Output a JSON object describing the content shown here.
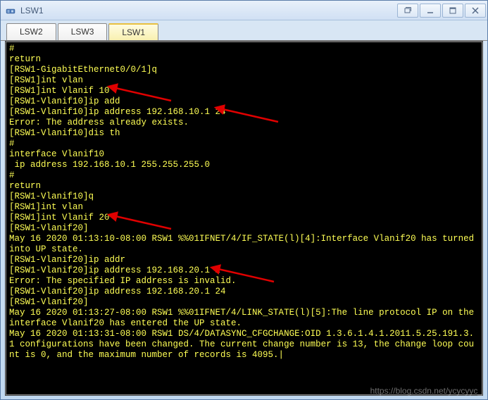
{
  "window": {
    "title": "LSW1"
  },
  "tabs": [
    {
      "label": "LSW2",
      "active": false
    },
    {
      "label": "LSW3",
      "active": false
    },
    {
      "label": "LSW1",
      "active": true
    }
  ],
  "terminal": {
    "lines": [
      "#",
      "return",
      "[RSW1-GigabitEthernet0/0/1]q",
      "[RSW1]int vlan",
      "[RSW1]int Vlanif 10",
      "[RSW1-Vlanif10]ip add",
      "[RSW1-Vlanif10]ip address 192.168.10.1 24",
      "Error: The address already exists.",
      "[RSW1-Vlanif10]dis th",
      "#",
      "interface Vlanif10",
      " ip address 192.168.10.1 255.255.255.0",
      "#",
      "return",
      "[RSW1-Vlanif10]q",
      "[RSW1]int vlan",
      "[RSW1]int Vlanif 20",
      "[RSW1-Vlanif20]",
      "May 16 2020 01:13:10-08:00 RSW1 %%01IFNET/4/IF_STATE(l)[4]:Interface Vlanif20 has turned into UP state.",
      "[RSW1-Vlanif20]ip addr",
      "[RSW1-Vlanif20]ip address 192.168.20.1 2",
      "Error: The specified IP address is invalid.",
      "[RSW1-Vlanif20]ip address 192.168.20.1 24",
      "[RSW1-Vlanif20]",
      "May 16 2020 01:13:27-08:00 RSW1 %%01IFNET/4/LINK_STATE(l)[5]:The line protocol IP on the interface Vlanif20 has entered the UP state.",
      "May 16 2020 01:13:31-08:00 RSW1 DS/4/DATASYNC_CFGCHANGE:OID 1.3.6.1.4.1.2011.5.25.191.3.1 configurations have been changed. The current change number is 13, the change loop count is 0, and the maximum number of records is 4095.|"
    ]
  },
  "watermark": "https://blog.csdn.net/ycycyyc_"
}
